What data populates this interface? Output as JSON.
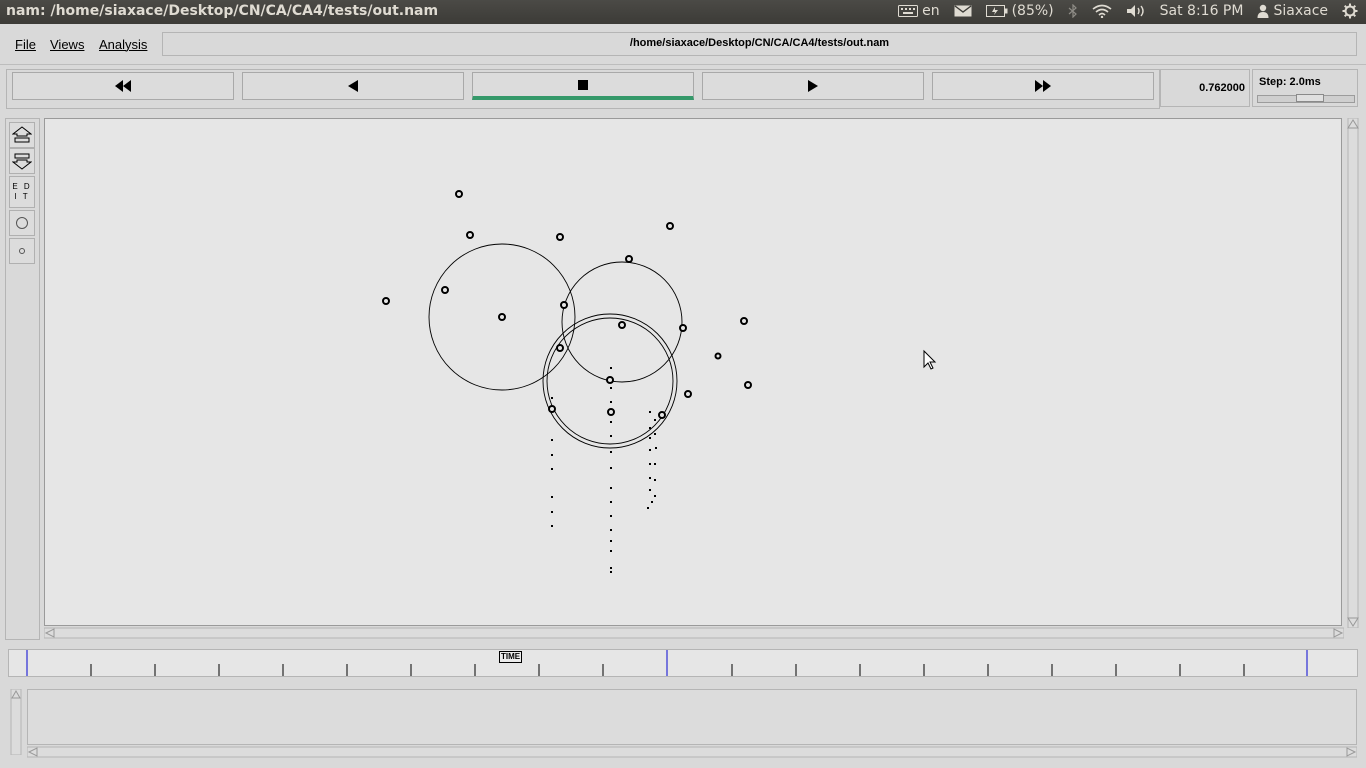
{
  "window": {
    "title": "nam: /home/siaxace/Desktop/CN/CA/CA4/tests/out.nam"
  },
  "tray": {
    "keyboard": "en",
    "battery": "(85%)",
    "clock": "Sat  8:16 PM",
    "user": "Siaxace",
    "icons": [
      "keyboard-icon",
      "mail-icon",
      "battery-icon",
      "bluetooth-icon",
      "wifi-icon",
      "volume-icon",
      "user-icon",
      "gear-icon"
    ]
  },
  "menu": {
    "file": "File",
    "views": "Views",
    "analysis": "Analysis",
    "path": "/home/siaxace/Desktop/CN/CA/CA4/tests/out.nam"
  },
  "controls": {
    "buttons": [
      "fast-rewind",
      "rewind",
      "stop",
      "play",
      "fast-forward"
    ],
    "active": "stop",
    "time": "0.762000",
    "step_label": "Step: 2.0ms"
  },
  "left_toolbar": {
    "edit_label": "EDIT",
    "tools": [
      "zoom-in-icon",
      "zoom-out-icon",
      "edit",
      "circle-tool-icon",
      "small-circle-tool-icon"
    ]
  },
  "timeline": {
    "label": "TIME"
  },
  "colors": {
    "active_indicator": "#35996a",
    "canvas_bg": "#e6e6e6",
    "window_bg": "#d9d9d9",
    "topbar_bg": "#3c3b37"
  }
}
